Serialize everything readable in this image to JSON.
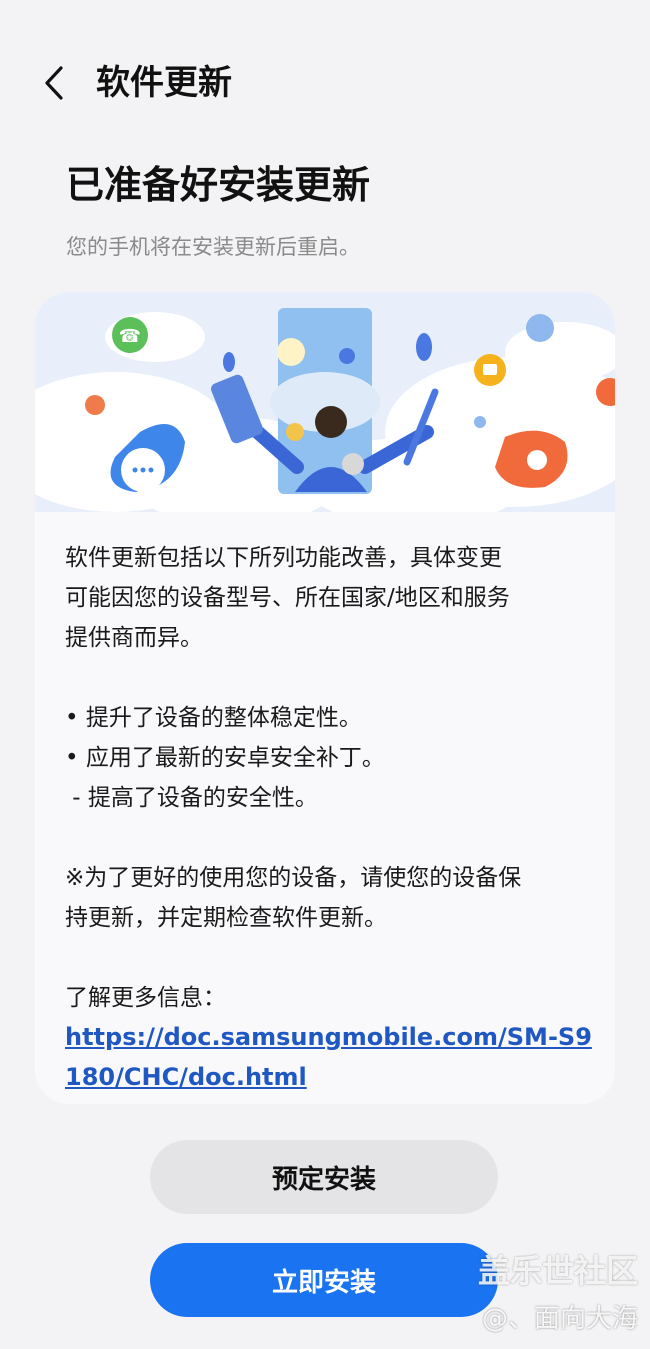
{
  "header": {
    "back_icon": "chevron-left-icon",
    "title": "软件更新"
  },
  "main": {
    "title": "已准备好安装更新",
    "subtitle": "您的手机将在安装更新后重启。"
  },
  "card": {
    "intro_line1": "软件更新包括以下所列功能改善，具体变更",
    "intro_line2": "可能因您的设备型号、所在国家/地区和服务",
    "intro_line3": "提供商而异。",
    "bullet1": "• 提升了设备的整体稳定性。",
    "bullet2": "• 应用了最新的安卓安全补丁。",
    "bullet3": " - 提高了设备的安全性。",
    "note_line1": "※为了更好的使用您的设备，请使您的设备保",
    "note_line2": "持更新，并定期检查软件更新。",
    "more_info_label": "了解更多信息：",
    "more_info_link": "https://doc.samsungmobile.com/SM-S9180/CHC/doc.html"
  },
  "buttons": {
    "schedule": "预定安装",
    "install_now": "立即安装"
  },
  "watermark": {
    "line1": "盖乐世社区",
    "line2": "@、面向大海"
  },
  "colors": {
    "accent": "#1a73f0",
    "link": "#1f57c3",
    "background": "#f3f3f5"
  }
}
